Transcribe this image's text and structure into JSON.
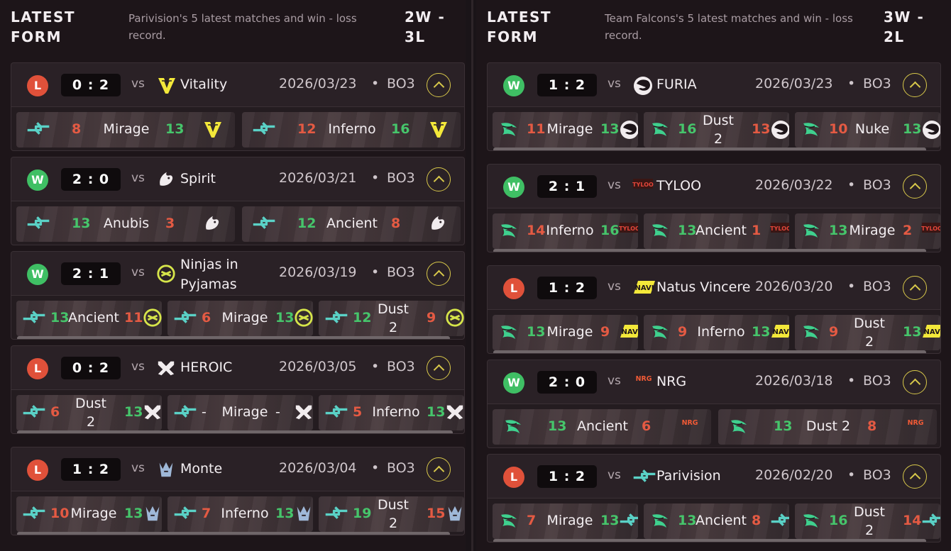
{
  "left": {
    "title": "LATEST FORM",
    "description": "Parivision's 5 latest matches and win - loss record.",
    "record": "2W - 3L",
    "matches": [
      {
        "result": "L",
        "score": "0 : 2",
        "vs": "vs",
        "opponent": "Vitality",
        "date": "2026/03/23",
        "dot": "•",
        "format": "BO3",
        "maps": [
          {
            "s1": "8",
            "name": "Mirage",
            "s2": "13"
          },
          {
            "s1": "12",
            "name": "Inferno",
            "s2": "16"
          }
        ]
      },
      {
        "result": "W",
        "score": "2 : 0",
        "vs": "vs",
        "opponent": "Spirit",
        "date": "2026/03/21",
        "dot": "•",
        "format": "BO3",
        "maps": [
          {
            "s1": "13",
            "name": "Anubis",
            "s2": "3"
          },
          {
            "s1": "12",
            "name": "Ancient",
            "s2": "8"
          }
        ]
      },
      {
        "result": "W",
        "score": "2 : 1",
        "vs": "vs",
        "opponent": "Ninjas in Pyjamas",
        "date": "2026/03/19",
        "dot": "•",
        "format": "BO3",
        "maps": [
          {
            "s1": "13",
            "name": "Ancient",
            "s2": "11"
          },
          {
            "s1": "6",
            "name": "Mirage",
            "s2": "13"
          },
          {
            "s1": "12",
            "name": "Dust 2",
            "s2": "9"
          }
        ]
      },
      {
        "result": "L",
        "score": "0 : 2",
        "vs": "vs",
        "opponent": "HEROIC",
        "date": "2026/03/05",
        "dot": "•",
        "format": "BO3",
        "maps": [
          {
            "s1": "6",
            "name": "Dust 2",
            "s2": "13"
          },
          {
            "s1": "-",
            "name": "Mirage",
            "s2": "-"
          },
          {
            "s1": "5",
            "name": "Inferno",
            "s2": "13"
          }
        ]
      },
      {
        "result": "L",
        "score": "1 : 2",
        "vs": "vs",
        "opponent": "Monte",
        "date": "2026/03/04",
        "dot": "•",
        "format": "BO3",
        "maps": [
          {
            "s1": "10",
            "name": "Mirage",
            "s2": "13"
          },
          {
            "s1": "7",
            "name": "Inferno",
            "s2": "13"
          },
          {
            "s1": "19",
            "name": "Dust 2",
            "s2": "15"
          }
        ]
      }
    ]
  },
  "right": {
    "title": "LATEST FORM",
    "description": "Team Falcons's 5 latest matches and win - loss record.",
    "record": "3W - 2L",
    "matches": [
      {
        "result": "W",
        "score": "1 : 2",
        "vs": "vs",
        "opponent": "FURIA",
        "date": "2026/03/23",
        "dot": "•",
        "format": "BO3",
        "maps": [
          {
            "s1": "11",
            "name": "Mirage",
            "s2": "13"
          },
          {
            "s1": "16",
            "name": "Dust 2",
            "s2": "13"
          },
          {
            "s1": "10",
            "name": "Nuke",
            "s2": "13"
          }
        ]
      },
      {
        "result": "W",
        "score": "2 : 1",
        "vs": "vs",
        "opponent": "TYLOO",
        "date": "2026/03/22",
        "dot": "•",
        "format": "BO3",
        "maps": [
          {
            "s1": "14",
            "name": "Inferno",
            "s2": "16"
          },
          {
            "s1": "13",
            "name": "Ancient",
            "s2": "1"
          },
          {
            "s1": "13",
            "name": "Mirage",
            "s2": "2"
          }
        ]
      },
      {
        "result": "L",
        "score": "1 : 2",
        "vs": "vs",
        "opponent": "Natus Vincere",
        "date": "2026/03/20",
        "dot": "•",
        "format": "BO3",
        "maps": [
          {
            "s1": "13",
            "name": "Mirage",
            "s2": "9"
          },
          {
            "s1": "9",
            "name": "Inferno",
            "s2": "13"
          },
          {
            "s1": "9",
            "name": "Dust 2",
            "s2": "13"
          }
        ]
      },
      {
        "result": "W",
        "score": "2 : 0",
        "vs": "vs",
        "opponent": "NRG",
        "date": "2026/03/18",
        "dot": "•",
        "format": "BO3",
        "maps": [
          {
            "s1": "13",
            "name": "Ancient",
            "s2": "6"
          },
          {
            "s1": "13",
            "name": "Dust 2",
            "s2": "8"
          }
        ]
      },
      {
        "result": "L",
        "score": "1 : 2",
        "vs": "vs",
        "opponent": "Parivision",
        "date": "2026/02/20",
        "dot": "•",
        "format": "BO3",
        "maps": [
          {
            "s1": "7",
            "name": "Mirage",
            "s2": "13"
          },
          {
            "s1": "13",
            "name": "Ancient",
            "s2": "8"
          },
          {
            "s1": "16",
            "name": "Dust 2",
            "s2": "14"
          }
        ]
      }
    ]
  },
  "colors": {
    "win": "#3fbf64",
    "loss": "#e0513a",
    "accent": "#d8c84a",
    "background": "#1d1519"
  },
  "icons": [
    "parivision-logo",
    "falcons-logo",
    "vitality-logo",
    "spirit-logo",
    "nip-logo",
    "heroic-logo",
    "monte-logo",
    "furia-logo",
    "tyloo-logo",
    "navi-logo",
    "nrg-logo",
    "chevron-up-icon"
  ]
}
